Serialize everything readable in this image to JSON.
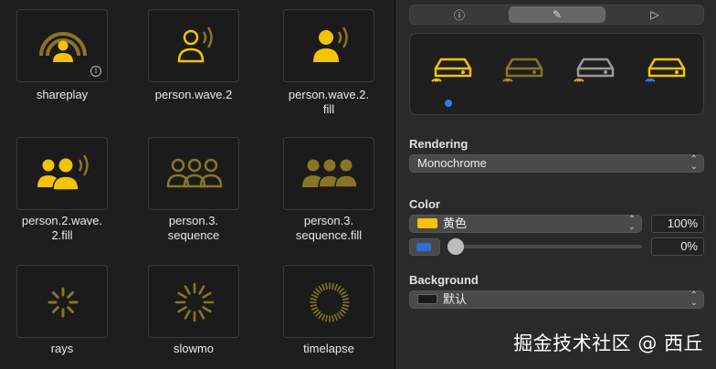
{
  "symbols": [
    {
      "name": "shareplay",
      "caption_lines": [
        "shareplay"
      ],
      "icon": "shareplay-icon",
      "has_info": true
    },
    {
      "name": "person.wave.2",
      "caption_lines": [
        "person.wave.2"
      ],
      "icon": "person-wave-2-icon"
    },
    {
      "name": "person.wave.2.fill",
      "caption_lines": [
        "person.wave.2.",
        "fill"
      ],
      "icon": "person-wave-2-fill-icon"
    },
    {
      "name": "person.2.wave.2.fill",
      "caption_lines": [
        "person.2.wave.",
        "2.fill"
      ],
      "icon": "person-2-wave-2-fill-icon"
    },
    {
      "name": "person.3.sequence",
      "caption_lines": [
        "person.3.",
        "sequence"
      ],
      "icon": "person-3-sequence-icon"
    },
    {
      "name": "person.3.sequence.fill",
      "caption_lines": [
        "person.3.",
        "sequence.fill"
      ],
      "icon": "person-3-sequence-fill-icon"
    },
    {
      "name": "rays",
      "caption_lines": [
        "rays"
      ],
      "icon": "rays-icon"
    },
    {
      "name": "slowmo",
      "caption_lines": [
        "slowmo"
      ],
      "icon": "slowmo-icon"
    },
    {
      "name": "timelapse",
      "caption_lines": [
        "timelapse"
      ],
      "icon": "timelapse-icon"
    }
  ],
  "inspector": {
    "tabs": [
      {
        "icon": "info-icon",
        "glyph": "ⓘ"
      },
      {
        "icon": "paintbrush-icon",
        "glyph": "✎"
      },
      {
        "icon": "play-icon",
        "glyph": "▷"
      }
    ],
    "active_tab": 1,
    "preview_variants": [
      "monochrome",
      "hierarchical",
      "palette",
      "multicolor"
    ],
    "rendering": {
      "label": "Rendering",
      "value": "Monochrome"
    },
    "color": {
      "label": "Color",
      "value": "黄色",
      "swatch": "#f5c400",
      "opacity": "100%",
      "slider_value": "0%"
    },
    "background": {
      "label": "Background",
      "value": "默认",
      "swatch": "#1a1a1a"
    }
  },
  "colors": {
    "accent": "#f5c400",
    "dim": "#8a7426",
    "blue": "#2f7bf5"
  },
  "watermark": "掘金技术社区 @ 西丘"
}
